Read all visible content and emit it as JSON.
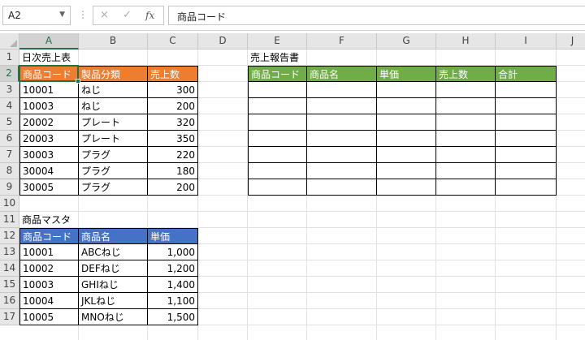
{
  "formula_bar": {
    "name_box": "A2",
    "cancel_icon": "×",
    "enter_icon": "✓",
    "fx_label": "fx",
    "formula": "商品コード"
  },
  "columns": [
    "A",
    "B",
    "C",
    "D",
    "E",
    "F",
    "G",
    "H",
    "I",
    "J"
  ],
  "rows": [
    "1",
    "2",
    "3",
    "4",
    "5",
    "6",
    "7",
    "8",
    "9",
    "10",
    "11",
    "12",
    "13",
    "14",
    "15",
    "16",
    "17"
  ],
  "colors": {
    "orange": "#ed7d31",
    "green": "#70ad47",
    "blue": "#4472c4",
    "excel_green": "#217346"
  },
  "daily_sales": {
    "title": "日次売上表",
    "headers": [
      "商品コード",
      "製品分類",
      "売上数"
    ],
    "rows": [
      [
        "10001",
        "ねじ",
        "300"
      ],
      [
        "10003",
        "ねじ",
        "200"
      ],
      [
        "20002",
        "プレート",
        "320"
      ],
      [
        "20003",
        "プレート",
        "350"
      ],
      [
        "30003",
        "プラグ",
        "220"
      ],
      [
        "30004",
        "プラグ",
        "180"
      ],
      [
        "30005",
        "プラグ",
        "200"
      ]
    ]
  },
  "product_master": {
    "title": "商品マスタ",
    "headers": [
      "商品コード",
      "商品名",
      "単価"
    ],
    "rows": [
      [
        "10001",
        "ABCねじ",
        "1,000"
      ],
      [
        "10002",
        "DEFねじ",
        "1,200"
      ],
      [
        "10003",
        "GHIねじ",
        "1,400"
      ],
      [
        "10004",
        "JKLねじ",
        "1,100"
      ],
      [
        "10005",
        "MNOねじ",
        "1,500"
      ]
    ]
  },
  "sales_report": {
    "title": "売上報告書",
    "headers": [
      "商品コード",
      "商品名",
      "単価",
      "売上数",
      "合計"
    ],
    "empty_rows": 7
  }
}
